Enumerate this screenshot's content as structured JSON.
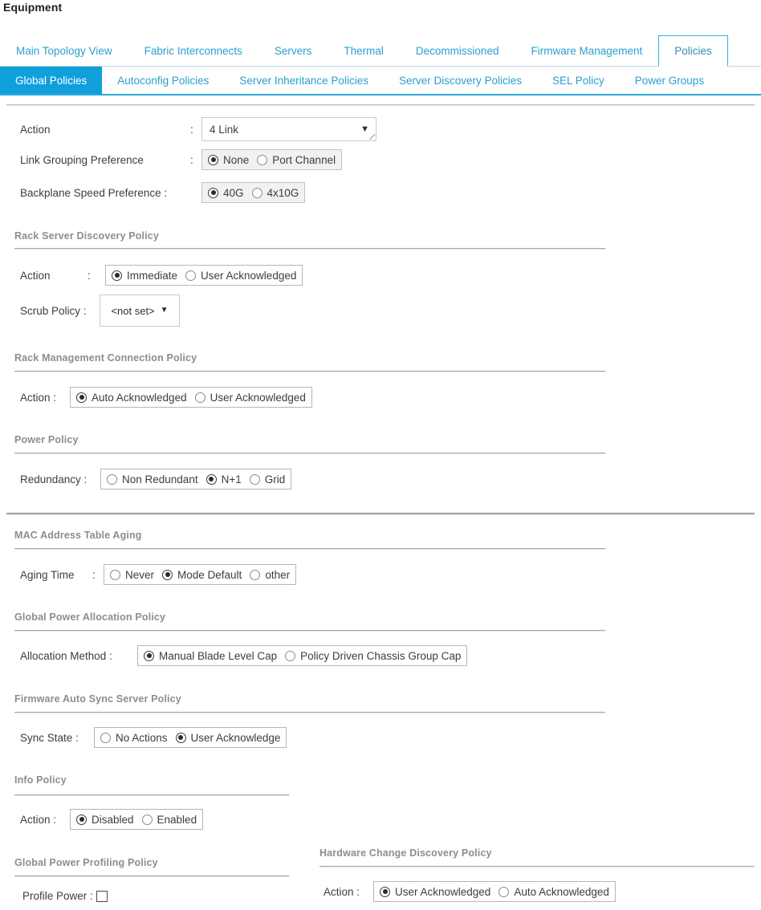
{
  "page_title": "Equipment",
  "colors": {
    "accent": "#0fa0dc",
    "tab_link": "#2a9fd0",
    "section_heading": "#8d8d8d",
    "label_text": "#3d3d3d"
  },
  "tabs": [
    {
      "label": "Main Topology View",
      "active": false
    },
    {
      "label": "Fabric Interconnects",
      "active": false
    },
    {
      "label": "Servers",
      "active": false
    },
    {
      "label": "Thermal",
      "active": false
    },
    {
      "label": "Decommissioned",
      "active": false
    },
    {
      "label": "Firmware Management",
      "active": false
    },
    {
      "label": "Policies",
      "active": true
    }
  ],
  "subtabs": [
    {
      "label": "Global Policies",
      "active": true
    },
    {
      "label": "Autoconfig Policies",
      "active": false
    },
    {
      "label": "Server Inheritance Policies",
      "active": false
    },
    {
      "label": "Server Discovery Policies",
      "active": false
    },
    {
      "label": "SEL Policy",
      "active": false
    },
    {
      "label": "Power Groups",
      "active": false
    }
  ],
  "chassis_discovery": {
    "action": {
      "label": "Action",
      "colon": ":",
      "value": "4 Link",
      "caret": "chevron-down-icon"
    },
    "link_grouping": {
      "label": "Link Grouping Preference",
      "colon": ":",
      "options": [
        {
          "label": "None",
          "checked": true
        },
        {
          "label": "Port Channel",
          "checked": false
        }
      ]
    },
    "backplane_speed": {
      "label": "Backplane Speed Preference :",
      "options": [
        {
          "label": "40G",
          "checked": true
        },
        {
          "label": "4x10G",
          "checked": false
        }
      ]
    }
  },
  "rack_server_discovery": {
    "heading": "Rack Server Discovery Policy",
    "action": {
      "label": "Action",
      "colon": ":",
      "options": [
        {
          "label": "Immediate",
          "checked": true
        },
        {
          "label": "User Acknowledged",
          "checked": false
        }
      ]
    },
    "scrub_policy": {
      "label": "Scrub Policy :",
      "value": "<not set>",
      "caret": "chevron-down-icon"
    }
  },
  "rack_management": {
    "heading": "Rack Management Connection Policy",
    "action": {
      "label": "Action :",
      "options": [
        {
          "label": "Auto Acknowledged",
          "checked": true
        },
        {
          "label": "User Acknowledged",
          "checked": false
        }
      ]
    }
  },
  "power_policy": {
    "heading": "Power Policy",
    "redundancy": {
      "label": "Redundancy :",
      "options": [
        {
          "label": "Non Redundant",
          "checked": false
        },
        {
          "label": "N+1",
          "checked": true
        },
        {
          "label": "Grid",
          "checked": false
        }
      ]
    }
  },
  "mac_aging": {
    "heading": "MAC Address Table Aging",
    "aging_time": {
      "label": "Aging Time",
      "colon": ":",
      "options": [
        {
          "label": "Never",
          "checked": false
        },
        {
          "label": "Mode Default",
          "checked": true
        },
        {
          "label": "other",
          "checked": false
        }
      ]
    }
  },
  "global_power_allocation": {
    "heading": "Global Power Allocation Policy",
    "allocation_method": {
      "label": "Allocation Method :",
      "options": [
        {
          "label": "Manual Blade Level Cap",
          "checked": true
        },
        {
          "label": "Policy Driven Chassis Group Cap",
          "checked": false
        }
      ]
    }
  },
  "firmware_auto_sync": {
    "heading": "Firmware Auto Sync Server Policy",
    "sync_state": {
      "label": "Sync State :",
      "options": [
        {
          "label": "No Actions",
          "checked": false
        },
        {
          "label": "User Acknowledge",
          "checked": true
        }
      ]
    }
  },
  "info_policy": {
    "heading": "Info Policy",
    "action": {
      "label": "Action :",
      "options": [
        {
          "label": "Disabled",
          "checked": true
        },
        {
          "label": "Enabled",
          "checked": false
        }
      ]
    }
  },
  "global_power_profiling": {
    "heading": "Global Power Profiling Policy",
    "profile_power": {
      "label": "Profile Power :",
      "checked": false
    }
  },
  "hardware_change_discovery": {
    "heading": "Hardware Change Discovery Policy",
    "action": {
      "label": "Action :",
      "options": [
        {
          "label": "User Acknowledged",
          "checked": true
        },
        {
          "label": "Auto Acknowledged",
          "checked": false
        }
      ]
    }
  }
}
